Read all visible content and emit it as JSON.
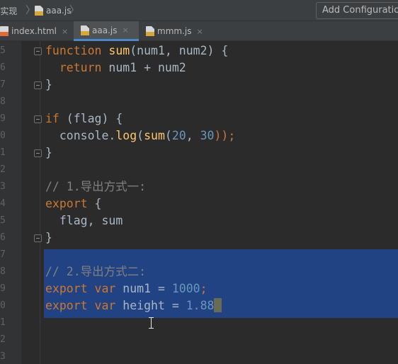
{
  "navbar": {
    "project_label": "Vue实现",
    "separator": "〉",
    "file_label": "aaa.js",
    "end_separator": "〉",
    "add_configuration_label": "Add Configuration..."
  },
  "tabs": [
    {
      "label": "index.html",
      "close": "×",
      "icon": "html-file-icon",
      "active": false
    },
    {
      "label": "aaa.js",
      "close": "×",
      "icon": "js-file-icon",
      "active": true
    },
    {
      "label": "mmm.js",
      "close": "×",
      "icon": "js-file-icon",
      "active": false
    }
  ],
  "gutter": {
    "line_digits": [
      "5",
      "6",
      "7",
      "8",
      "9",
      "0",
      "1",
      "2",
      "3",
      "4",
      "5",
      "6",
      "7",
      "8",
      "9",
      "0",
      "1",
      "2",
      "3"
    ]
  },
  "code": {
    "l5": {
      "kw": "function",
      "sp": " ",
      "fn": "sum",
      "rest": "(num1, num2) {"
    },
    "l6": {
      "indent": "  ",
      "kw": "return",
      "rest": " num1 + num2"
    },
    "l7": {
      "text": "}"
    },
    "l9": {
      "kw": "if",
      "rest": " (flag) {"
    },
    "l10": {
      "indent": "  ",
      "obj": "console.",
      "fn1": "log",
      "p1": "(",
      "fn2": "sum",
      "p2": "(",
      "n1": "20",
      "comma": ", ",
      "n2": "30",
      "end": "));"
    },
    "l11": {
      "text": "}"
    },
    "l13": {
      "comment": "// 1.导出方式一:"
    },
    "l14": {
      "kw": "export",
      "rest": " {"
    },
    "l15": {
      "text": "  flag, sum"
    },
    "l16": {
      "text": "}"
    },
    "l18": {
      "comment": "// 2.导出方式二:"
    },
    "l19": {
      "kw1": "export",
      "sp1": " ",
      "kw2": "var",
      "mid": " num1 = ",
      "num": "1000",
      "end": ";"
    },
    "l20": {
      "kw1": "export",
      "sp1": " ",
      "kw2": "var",
      "mid": " height = ",
      "num": "1.88"
    }
  },
  "colors": {
    "background": "#2b2b2b",
    "keyword": "#cc7832",
    "function": "#ffc66d",
    "number": "#6897bb",
    "comment": "#808080",
    "selection": "#214283",
    "tab_active_underline": "#4a88c7"
  }
}
